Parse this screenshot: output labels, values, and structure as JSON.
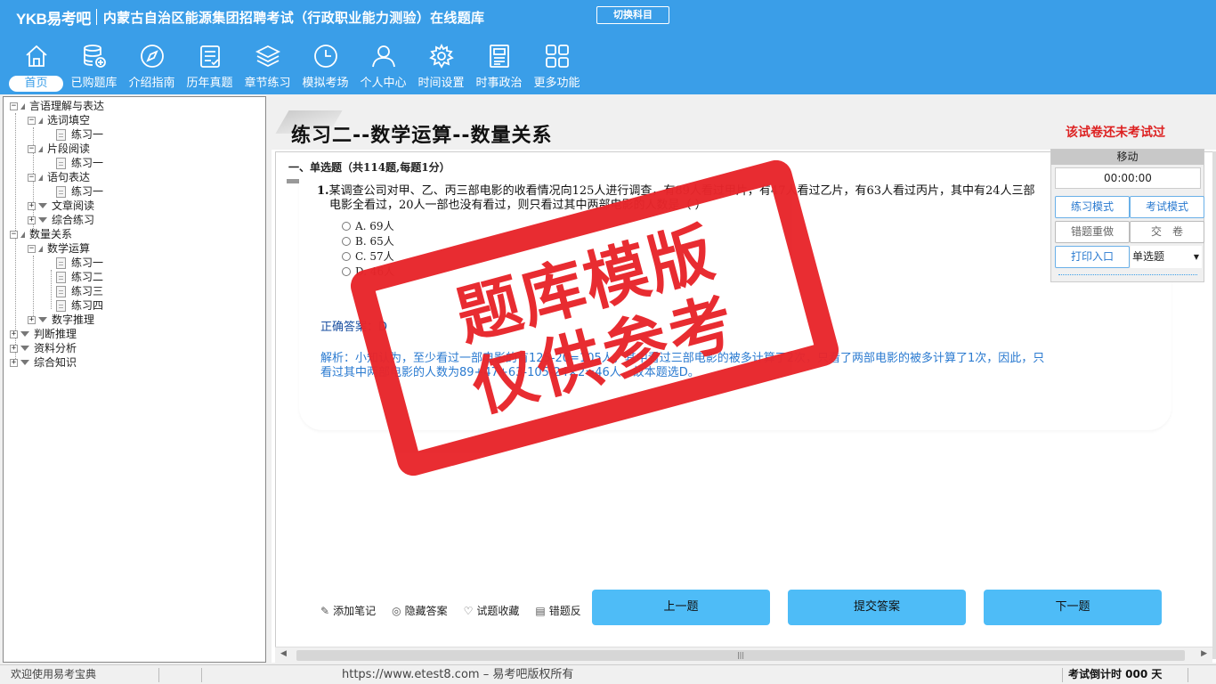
{
  "header": {
    "logo": "YKB易考吧",
    "title": "内蒙古自治区能源集团招聘考试（行政职业能力测验）在线题库",
    "switch_button": "切换科目"
  },
  "nav": [
    {
      "label": "首页",
      "icon": "home-icon",
      "active": true
    },
    {
      "label": "已购题库",
      "icon": "database-add-icon"
    },
    {
      "label": "介绍指南",
      "icon": "compass-icon"
    },
    {
      "label": "历年真题",
      "icon": "checklist-icon"
    },
    {
      "label": "章节练习",
      "icon": "layers-icon"
    },
    {
      "label": "模拟考场",
      "icon": "clock-icon"
    },
    {
      "label": "个人中心",
      "icon": "user-icon"
    },
    {
      "label": "时间设置",
      "icon": "gear-icon"
    },
    {
      "label": "时事政治",
      "icon": "news-icon"
    },
    {
      "label": "更多功能",
      "icon": "grid-icon"
    }
  ],
  "tree": {
    "n1": "言语理解与表达",
    "n1a": "选词填空",
    "n1a1": "练习一",
    "n1b": "片段阅读",
    "n1b1": "练习一",
    "n1c": "语句表达",
    "n1c1": "练习一",
    "n1d": "文章阅读",
    "n1e": "综合练习",
    "n2": "数量关系",
    "n2a": "数学运算",
    "n2a1": "练习一",
    "n2a2": "练习二",
    "n2a3": "练习三",
    "n2a4": "练习四",
    "n2b": "数字推理",
    "n3": "判断推理",
    "n4": "资料分析",
    "n5": "综合知识"
  },
  "content": {
    "title": "练习二--数学运算--数量关系",
    "status": "该试卷还未考试过",
    "section": "一、单选题（共114题,每题1分）",
    "question_number": "1.",
    "question_line1": "某调查公司对甲、乙、丙三部电影的收看情况向125人进行调查，有89人看过甲片，有47人看过乙片，有63人看过丙片，其中有24人三部",
    "question_line2": "电影全看过，20人一部也没有看过，则只看过其中两部电影的人数是（  ）",
    "options": [
      "A. 69人",
      "B. 65人",
      "C. 57人",
      "D. 46人"
    ],
    "answer": "正确答案：D",
    "analysis_line1": "解析：小知认为，至少看过一部电影的有125-20=105人，其中看过三部电影的被多计算了2次，只看了两部电影的被多计算了1次，因此，只",
    "analysis_line2": "看过其中两部电影的人数为89+47+63-105-24×2=46人，故本题选D。"
  },
  "tools": {
    "note": "添加笔记",
    "hide": "隐藏答案",
    "fav": "试题收藏",
    "report": "错题反"
  },
  "buttons": {
    "prev": "上一题",
    "submit": "提交答案",
    "next": "下一题"
  },
  "control": {
    "move": "移动",
    "timer": "00:00:00",
    "practice": "练习模式",
    "exam": "考试模式",
    "redo": "错题重做",
    "hand_in": "交　卷",
    "print": "打印入口",
    "type": "单选题"
  },
  "watermark": {
    "line1": "题库模版",
    "line2": "仅供参考"
  },
  "status_bar": {
    "welcome": "欢迎使用易考宝典",
    "url": "https://www.etest8.com – 易考吧版权所有",
    "countdown": "考试倒计时 000 天"
  },
  "colors": {
    "header": "#3a9ee8",
    "button": "#4ebcf7",
    "stamp": "#e8262b",
    "status_red": "#dd2222"
  }
}
